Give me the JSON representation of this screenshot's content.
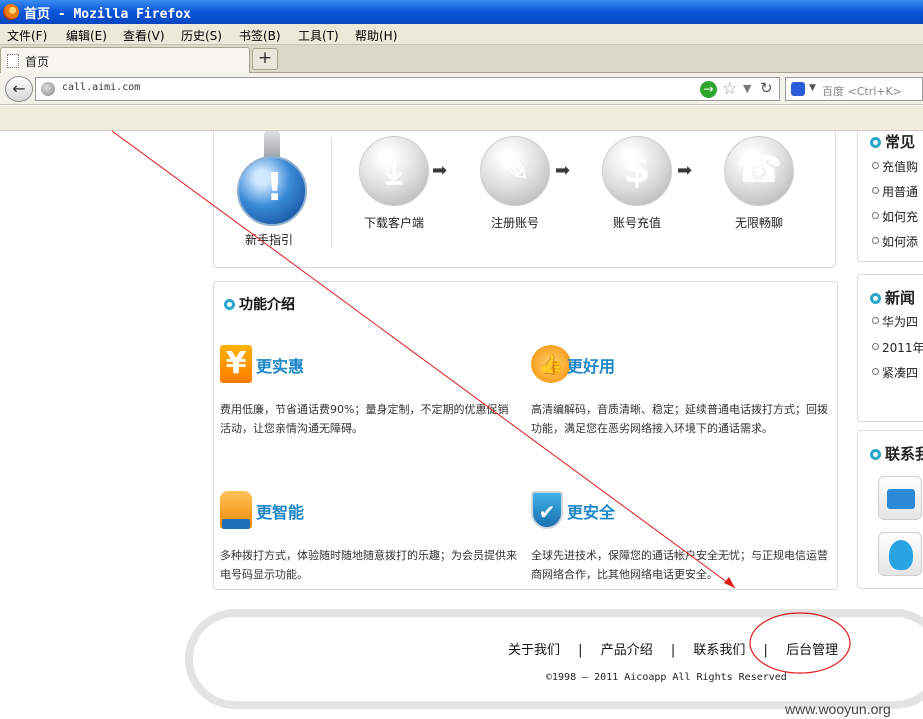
{
  "window": {
    "title": "首页 - Mozilla Firefox"
  },
  "menu": [
    "文件(F)",
    "编辑(E)",
    "查看(V)",
    "历史(S)",
    "书签(B)",
    "工具(T)",
    "帮助(H)"
  ],
  "tab": {
    "label": "首页",
    "new_tab_label": "+"
  },
  "navbar": {
    "url": "call.aimi.com",
    "search_engine": "百度",
    "search_placeholder": "百度 <Ctrl+K>"
  },
  "steps": {
    "guide_label": "新手指引",
    "items": [
      {
        "label": "下载客户端",
        "icon": "download-icon"
      },
      {
        "label": "注册账号",
        "icon": "edit-icon"
      },
      {
        "label": "账号充值",
        "icon": "dollar-icon"
      },
      {
        "label": "无限畅聊",
        "icon": "mobile-phone-icon"
      }
    ]
  },
  "features": {
    "title": "功能介绍",
    "items": [
      {
        "name": "更实惠",
        "icon": "yuan-icon",
        "desc": "费用低廉，节省通话费90%；量身定制，不定期的优惠促销活动，让您亲情沟通无障碍。"
      },
      {
        "name": "更好用",
        "icon": "thumbs-up-icon",
        "desc": "高清编解码，音质清晰、稳定；延续普通电话拨打方式；回拨功能，满足您在恶劣网络接入环境下的通话需求。"
      },
      {
        "name": "更智能",
        "icon": "pointing-hand-icon",
        "desc": "多种拨打方式，体验随时随地随意拨打的乐趣；为会员提供来电号码显示功能。"
      },
      {
        "name": "更安全",
        "icon": "shield-check-icon",
        "desc": "全球先进技术，保障您的通话帐户安全无忧；与正规电信运营商网络合作，比其他网络电话更安全。"
      }
    ]
  },
  "sidebar": {
    "faq": {
      "title": "常见",
      "items": [
        "充值购",
        "用普通",
        "如何充",
        "如何添"
      ]
    },
    "news": {
      "title": "新闻",
      "items": [
        "华为四",
        "2011年",
        "紧凑四"
      ]
    },
    "contact": {
      "title": "联系我"
    }
  },
  "footer": {
    "links": [
      "关于我们",
      "产品介绍",
      "联系我们",
      "后台管理"
    ],
    "separator": "|",
    "copyright": "©1998 — 2011 Aicoapp All Rights Reserved"
  },
  "watermark": "www.wooyun.org",
  "colors": {
    "accent": "#1b86c8",
    "bullet": "#2aa6cc",
    "annotation_red": "#e01818"
  }
}
